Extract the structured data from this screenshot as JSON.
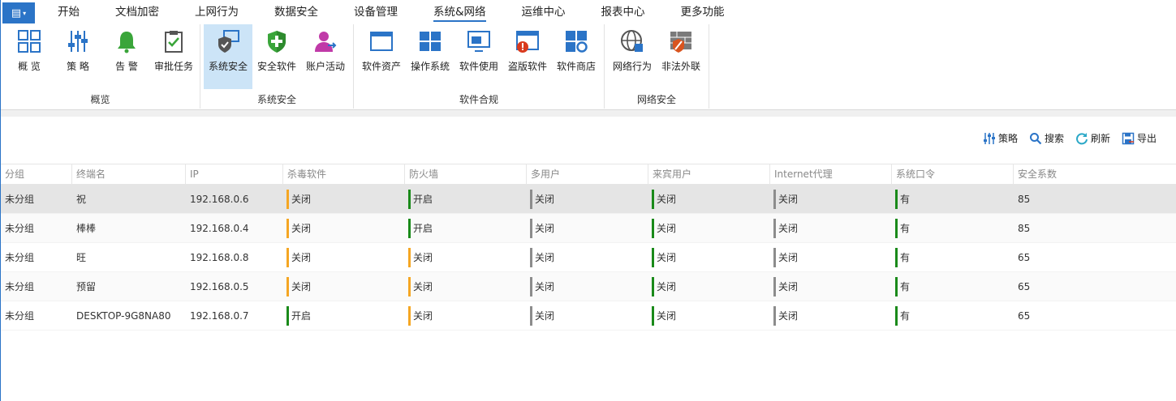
{
  "menu": {
    "app_button_icon": "app-menu-icon",
    "tabs": [
      {
        "label": "开始",
        "active": false
      },
      {
        "label": "文档加密",
        "active": false
      },
      {
        "label": "上网行为",
        "active": false
      },
      {
        "label": "数据安全",
        "active": false
      },
      {
        "label": "设备管理",
        "active": false
      },
      {
        "label": "系统&网络",
        "active": true
      },
      {
        "label": "运维中心",
        "active": false
      },
      {
        "label": "报表中心",
        "active": false
      },
      {
        "label": "更多功能",
        "active": false
      }
    ]
  },
  "ribbon": {
    "groups": [
      {
        "label": "概览",
        "buttons": [
          {
            "label": "概 览",
            "icon": "overview-grid-icon"
          },
          {
            "label": "策 略",
            "icon": "policy-sliders-icon"
          },
          {
            "label": "告 警",
            "icon": "alarm-bell-icon"
          },
          {
            "label": "审批任务",
            "icon": "approval-clipboard-icon"
          }
        ]
      },
      {
        "label": "系统安全",
        "buttons": [
          {
            "label": "系统安全",
            "icon": "system-security-shield-icon",
            "active": true
          },
          {
            "label": "安全软件",
            "icon": "security-software-shield-icon"
          },
          {
            "label": "账户活动",
            "icon": "account-activity-icon"
          }
        ]
      },
      {
        "label": "软件合规",
        "buttons": [
          {
            "label": "软件资产",
            "icon": "software-assets-window-icon"
          },
          {
            "label": "操作系统",
            "icon": "operating-system-icon"
          },
          {
            "label": "软件使用",
            "icon": "software-usage-icon"
          },
          {
            "label": "盗版软件",
            "icon": "pirated-software-icon"
          },
          {
            "label": "软件商店",
            "icon": "software-store-icon"
          }
        ]
      },
      {
        "label": "网络安全",
        "buttons": [
          {
            "label": "网络行为",
            "icon": "network-behavior-globe-icon"
          },
          {
            "label": "非法外联",
            "icon": "illegal-connection-firewall-icon"
          }
        ]
      }
    ]
  },
  "toolbar": {
    "policy": "策略",
    "search": "搜索",
    "refresh": "刷新",
    "export": "导出"
  },
  "table": {
    "columns": [
      "分组",
      "终端名",
      "IP",
      "杀毒软件",
      "防火墙",
      "多用户",
      "来宾用户",
      "Internet代理",
      "系统口令",
      "安全系数"
    ],
    "rows": [
      {
        "group": "未分组",
        "name": "祝",
        "ip": "192.168.0.6",
        "antivirus": "关闭",
        "firewall": "开启",
        "multiuser": "关闭",
        "guest": "关闭",
        "proxy": "关闭",
        "password": "有",
        "score": "85"
      },
      {
        "group": "未分组",
        "name": "棒棒",
        "ip": "192.168.0.4",
        "antivirus": "关闭",
        "firewall": "开启",
        "multiuser": "关闭",
        "guest": "关闭",
        "proxy": "关闭",
        "password": "有",
        "score": "85"
      },
      {
        "group": "未分组",
        "name": "旺",
        "ip": "192.168.0.8",
        "antivirus": "关闭",
        "firewall": "关闭",
        "multiuser": "关闭",
        "guest": "关闭",
        "proxy": "关闭",
        "password": "有",
        "score": "65"
      },
      {
        "group": "未分组",
        "name": "预留",
        "ip": "192.168.0.5",
        "antivirus": "关闭",
        "firewall": "关闭",
        "multiuser": "关闭",
        "guest": "关闭",
        "proxy": "关闭",
        "password": "有",
        "score": "65"
      },
      {
        "group": "未分组",
        "name": "DESKTOP-9G8NA80",
        "ip": "192.168.0.7",
        "antivirus": "开启",
        "firewall": "关闭",
        "multiuser": "关闭",
        "guest": "关闭",
        "proxy": "关闭",
        "password": "有",
        "score": "65"
      }
    ],
    "status_colors": {
      "warn": "#f5a623",
      "ok": "#1a8a1a",
      "neutral": "#8c8c8c"
    }
  },
  "colors": {
    "accent": "#2b74c7",
    "selected_button": "#cce4f7",
    "selected_row": "#e5e5e5"
  }
}
